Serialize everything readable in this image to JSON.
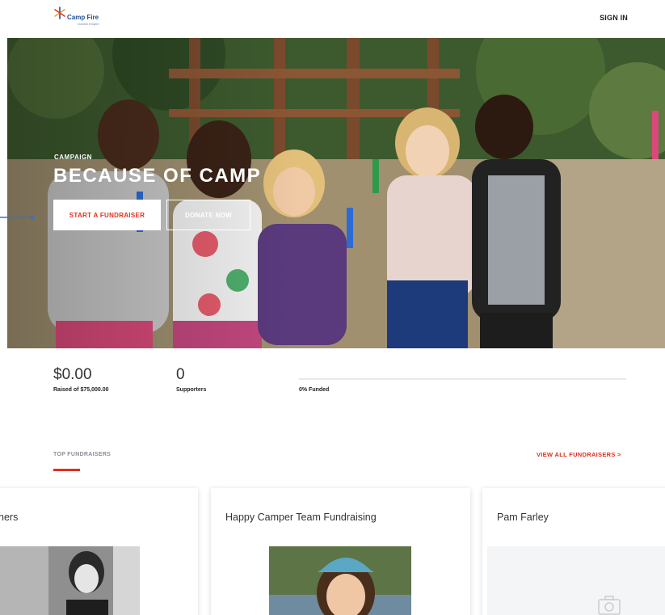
{
  "header": {
    "logo_text": "Camp Fire",
    "logo_subtext": "Golden Empire",
    "signin_label": "SIGN IN"
  },
  "hero": {
    "eyebrow": "CAMPAIGN",
    "title": "BECAUSE OF CAMP",
    "start_fundraiser_label": "START A FUNDRAISER",
    "donate_label": "DONATE NOW"
  },
  "stats": {
    "raised_amount": "$0.00",
    "raised_label": "Raised of $75,000.00",
    "supporters_count": "0",
    "supporters_label": "Supporters",
    "funded_percent": 0,
    "funded_label": "0% Funded"
  },
  "fundraisers": {
    "section_title": "TOP FUNDRAISERS",
    "view_all_label": "VIEW ALL FUNDRAISERS   >",
    "cards": [
      {
        "title": "ners"
      },
      {
        "title": "Happy Camper Team Fundraising"
      },
      {
        "title": "Pam Farley"
      }
    ]
  },
  "colors": {
    "accent_red": "#e0301e",
    "brand_blue": "#1d4f91"
  }
}
